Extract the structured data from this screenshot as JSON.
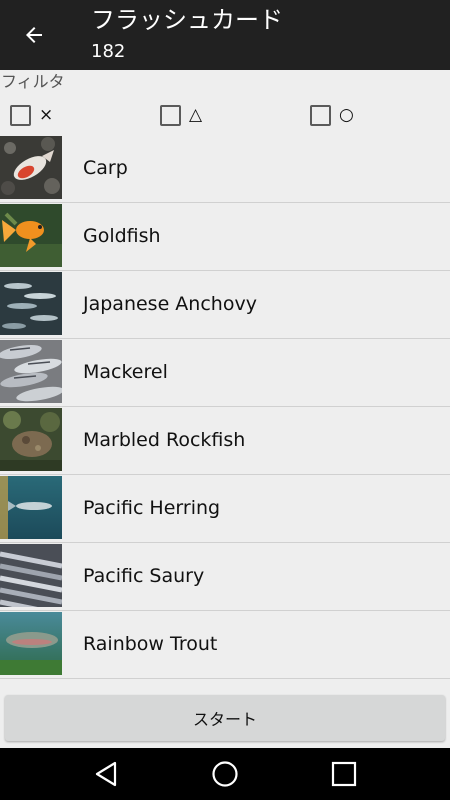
{
  "appbar": {
    "back_icon": "arrow-left-icon",
    "title": "フラッシュカード",
    "subtitle": "182"
  },
  "filter": {
    "label": "フィルタ",
    "options": [
      {
        "label": "×",
        "checked": false
      },
      {
        "label": "△",
        "checked": false
      },
      {
        "label": "○",
        "checked": false
      }
    ]
  },
  "fish_list": [
    {
      "name": "Carp"
    },
    {
      "name": "Goldfish"
    },
    {
      "name": "Japanese Anchovy"
    },
    {
      "name": "Mackerel"
    },
    {
      "name": "Marbled Rockfish"
    },
    {
      "name": "Pacific Herring"
    },
    {
      "name": "Pacific Saury"
    },
    {
      "name": "Rainbow Trout"
    }
  ],
  "start_button": {
    "label": "スタート"
  },
  "navbar": {
    "back_icon": "nav-back-icon",
    "home_icon": "nav-home-icon",
    "recents_icon": "nav-recents-icon"
  }
}
